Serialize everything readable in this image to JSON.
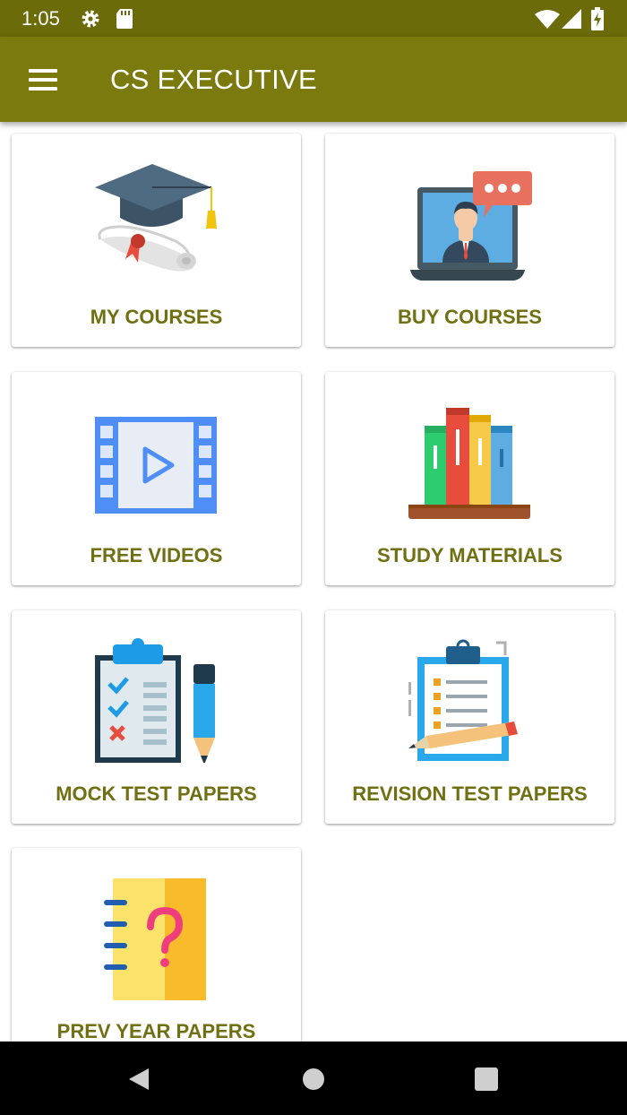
{
  "status_bar": {
    "time": "1:05",
    "icons": [
      "settings-icon",
      "sd-card-icon",
      "wifi-icon",
      "signal-icon",
      "battery-charging-icon"
    ]
  },
  "app_bar": {
    "title": "CS EXECUTIVE",
    "menu_icon": "hamburger-menu-icon",
    "color": "#7b7a0f"
  },
  "menu": {
    "label_color": "#707012",
    "items": [
      {
        "label": "MY COURSES",
        "icon": "graduation-cap-icon"
      },
      {
        "label": "BUY COURSES",
        "icon": "online-teacher-icon"
      },
      {
        "label": "FREE VIDEOS",
        "icon": "video-film-icon"
      },
      {
        "label": "STUDY MATERIALS",
        "icon": "books-shelf-icon"
      },
      {
        "label": "MOCK TEST PAPERS",
        "icon": "checklist-clipboard-icon"
      },
      {
        "label": "REVISION TEST PAPERS",
        "icon": "revision-clipboard-icon"
      },
      {
        "label": "PREV YEAR PAPERS",
        "icon": "question-notebook-icon"
      }
    ]
  },
  "nav_bar": {
    "buttons": [
      "back-icon",
      "home-icon",
      "recents-icon"
    ]
  }
}
